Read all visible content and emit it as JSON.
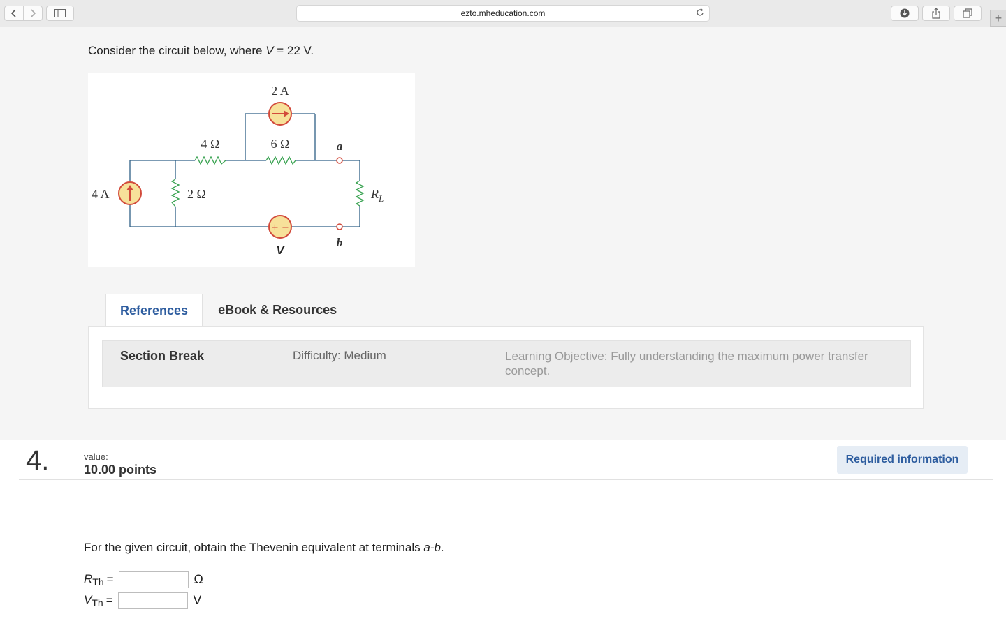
{
  "browser": {
    "url": "ezto.mheducation.com",
    "back_icon": "chevron-left-icon",
    "forward_icon": "chevron-right-icon",
    "new_tab_label": "+"
  },
  "intro": {
    "prefix": "Consider the circuit below, where ",
    "var": "V",
    "suffix": " = 22 V."
  },
  "circuit": {
    "current_top": "2 A",
    "r1": "4 Ω",
    "r2": "6 Ω",
    "r3": "2 Ω",
    "current_left": "4 A",
    "node_a": "a",
    "node_b": "b",
    "load": "R",
    "load_sub": "L",
    "source_v": "V",
    "plus_minus": "+ −",
    "wire_color": "#2e5f86",
    "resistor_color": "#3aa352",
    "source_fill": "#f7e19a",
    "source_stroke": "#d24a3b"
  },
  "tabs": [
    {
      "label": "References",
      "active": true
    },
    {
      "label": "eBook & Resources",
      "active": false
    }
  ],
  "reference": {
    "section": "Section Break",
    "difficulty": "Difficulty: Medium",
    "objective": "Learning Objective: Fully understanding the maximum power transfer concept."
  },
  "question": {
    "number": "4.",
    "value_label": "value:",
    "points": "10.00 points",
    "required": "Required information",
    "prompt_prefix": "For the given circuit, obtain the Thevenin equivalent at terminals ",
    "prompt_terms": "a-b",
    "prompt_suffix": ".",
    "answers": [
      {
        "var": "R",
        "sub": "Th",
        "eq": "=",
        "value": "",
        "unit": "Ω"
      },
      {
        "var": "V",
        "sub": "Th",
        "eq": "=",
        "value": "",
        "unit": "V"
      }
    ]
  }
}
